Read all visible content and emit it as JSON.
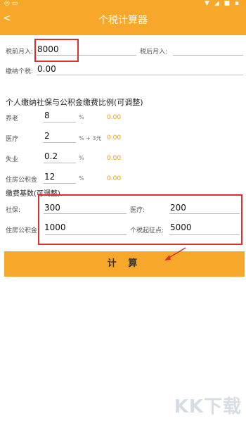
{
  "status": {
    "left": "◎ ▭",
    "right": "▼ ◢ ■ ▪"
  },
  "header": {
    "title": "个税计算器",
    "back": "<"
  },
  "top": {
    "pre_tax_label": "税前月入:",
    "pre_tax_value": "8000",
    "post_tax_label": "税后月入:",
    "tax_label": "缴纳个税:",
    "tax_value": "0.00"
  },
  "ratio": {
    "title": "个人缴纳社保与公积金缴费比例(可调整)",
    "rows": [
      {
        "label": "养老",
        "value": "8",
        "unit": "%",
        "amount": "0.00"
      },
      {
        "label": "医疗",
        "value": "2",
        "unit": "% + 3元",
        "amount": "0.00"
      },
      {
        "label": "失业",
        "value": "0.2",
        "unit": "%",
        "amount": "0.00"
      },
      {
        "label": "住房公积金",
        "value": "12",
        "unit": "%",
        "amount": "0.00"
      }
    ]
  },
  "base": {
    "title": "缴费基数(可调整)",
    "social_label": "社保:",
    "social_value": "300",
    "medical_label": "医疗:",
    "medical_value": "200",
    "housing_label": "住房公积金:",
    "housing_value": "1000",
    "threshold_label": "个税起征点:",
    "threshold_value": "5000"
  },
  "actions": {
    "calculate": "计 算"
  },
  "watermark": "KK下载",
  "colors": {
    "accent": "#f7a82a",
    "highlight": "#d9322e",
    "amount": "#f0a000"
  }
}
